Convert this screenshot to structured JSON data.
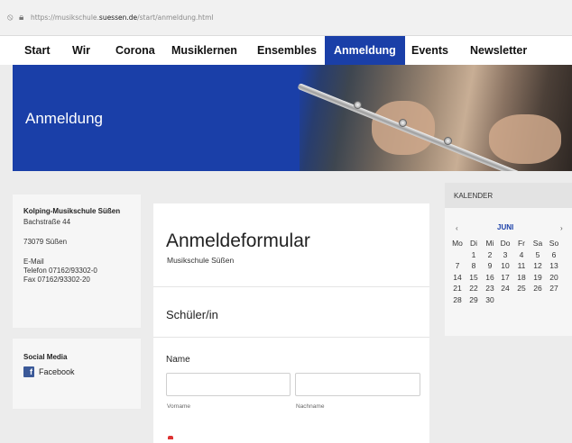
{
  "browser": {
    "url_prefix": "https://musikschule.",
    "url_domain": "suessen.de",
    "url_path": "/start/anmeldung.html"
  },
  "nav": {
    "items": [
      "Start",
      "Wir",
      "Corona",
      "Musiklernen",
      "Ensembles",
      "Anmeldung",
      "Events",
      "Newsletter"
    ],
    "active": "Anmeldung"
  },
  "hero": {
    "title": "Anmeldung"
  },
  "address": {
    "org": "Kolping-Musikschule Süßen",
    "street": "Bachstraße 44",
    "city": "73079 Süßen",
    "email": "E-Mail",
    "phone": "Telefon 07162/93302-0",
    "fax": "Fax 07162/93302-20"
  },
  "social": {
    "heading": "Social Media",
    "facebook": "Facebook"
  },
  "form": {
    "title": "Anmeldeformular",
    "subtitle": "Musikschule Süßen",
    "section": "Schüler/in",
    "name_label": "Name",
    "first_name_hint": "Vorname",
    "last_name_hint": "Nachname",
    "first_name_value": "",
    "last_name_value": ""
  },
  "calendar": {
    "heading": "KALENDER",
    "month": "JUNI",
    "prev": "‹",
    "next": "›",
    "weekdays": [
      "Mo",
      "Di",
      "Mi",
      "Do",
      "Fr",
      "Sa",
      "So"
    ],
    "weeks": [
      [
        "",
        "1",
        "2",
        "3",
        "4",
        "5",
        "6"
      ],
      [
        "7",
        "8",
        "9",
        "10",
        "11",
        "12",
        "13"
      ],
      [
        "14",
        "15",
        "16",
        "17",
        "18",
        "19",
        "20"
      ],
      [
        "21",
        "22",
        "23",
        "24",
        "25",
        "26",
        "27"
      ],
      [
        "28",
        "29",
        "30",
        "",
        "",
        "",
        ""
      ]
    ]
  },
  "colors": {
    "brand_blue": "#1a3fa8",
    "facebook": "#3b5998"
  }
}
